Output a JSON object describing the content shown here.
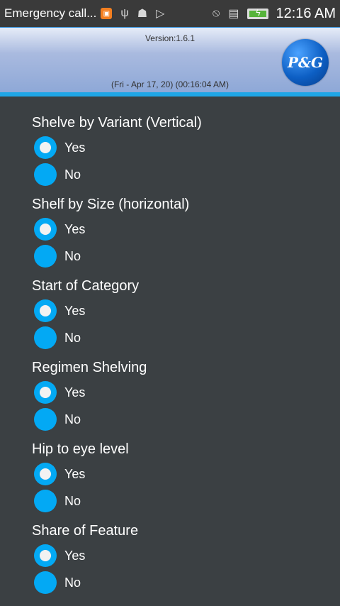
{
  "status_bar": {
    "notification_text": "Emergency call...",
    "time": "12:16 AM",
    "icons": [
      "app-notification-icon",
      "usb-icon",
      "android-debug-icon",
      "play-store-icon",
      "mute-icon",
      "sim-icon",
      "battery-charging-icon"
    ]
  },
  "header": {
    "version": "Version:1.6.1",
    "datetime": "(Fri - Apr 17, 20) (00:16:04 AM)",
    "logo_text": "P&G"
  },
  "questions": [
    {
      "label": "Shelve by Variant (Vertical)",
      "options": [
        {
          "label": "Yes",
          "selected": true
        },
        {
          "label": "No",
          "selected": false
        }
      ]
    },
    {
      "label": "Shelf by Size (horizontal)",
      "options": [
        {
          "label": "Yes",
          "selected": true
        },
        {
          "label": "No",
          "selected": false
        }
      ]
    },
    {
      "label": "Start of Category",
      "options": [
        {
          "label": "Yes",
          "selected": true
        },
        {
          "label": "No",
          "selected": false
        }
      ]
    },
    {
      "label": "Regimen Shelving",
      "options": [
        {
          "label": "Yes",
          "selected": true
        },
        {
          "label": "No",
          "selected": false
        }
      ]
    },
    {
      "label": "Hip to eye level",
      "options": [
        {
          "label": "Yes",
          "selected": true
        },
        {
          "label": "No",
          "selected": false
        }
      ]
    },
    {
      "label": "Share of Feature",
      "options": [
        {
          "label": "Yes",
          "selected": true
        },
        {
          "label": "No",
          "selected": false
        }
      ]
    }
  ],
  "colors": {
    "background": "#3b4043",
    "radio_accent": "#03a9f4",
    "header_accent": "#1fa6e6"
  }
}
